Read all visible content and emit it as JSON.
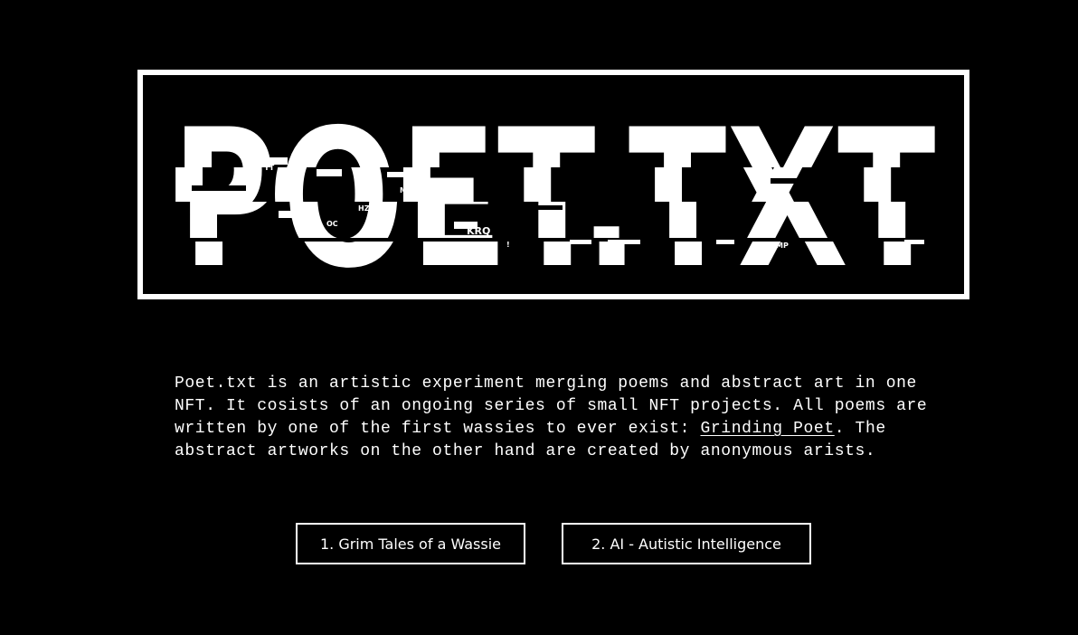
{
  "logo": {
    "title": "POET.TXT",
    "glitch_fragments": [
      "YT",
      "MXBE",
      "HZA",
      "OC",
      "KRQ",
      "!",
      "MP"
    ]
  },
  "intro": {
    "text_before_link": "Poet.txt is an artistic experiment merging poems and abstract art in one NFT. It cosists of an ongoing series of small NFT projects. All poems are written by one of the first wassies to ever exist: ",
    "link_text": "Grinding Poet",
    "text_after_link": ". The abstract artworks on the other hand are created by anonymous arists."
  },
  "buttons": {
    "project_1": "1. Grim Tales of a Wassie",
    "project_2": "2. AI - Autistic Intelligence"
  },
  "colors": {
    "background": "#000000",
    "foreground": "#ffffff"
  }
}
